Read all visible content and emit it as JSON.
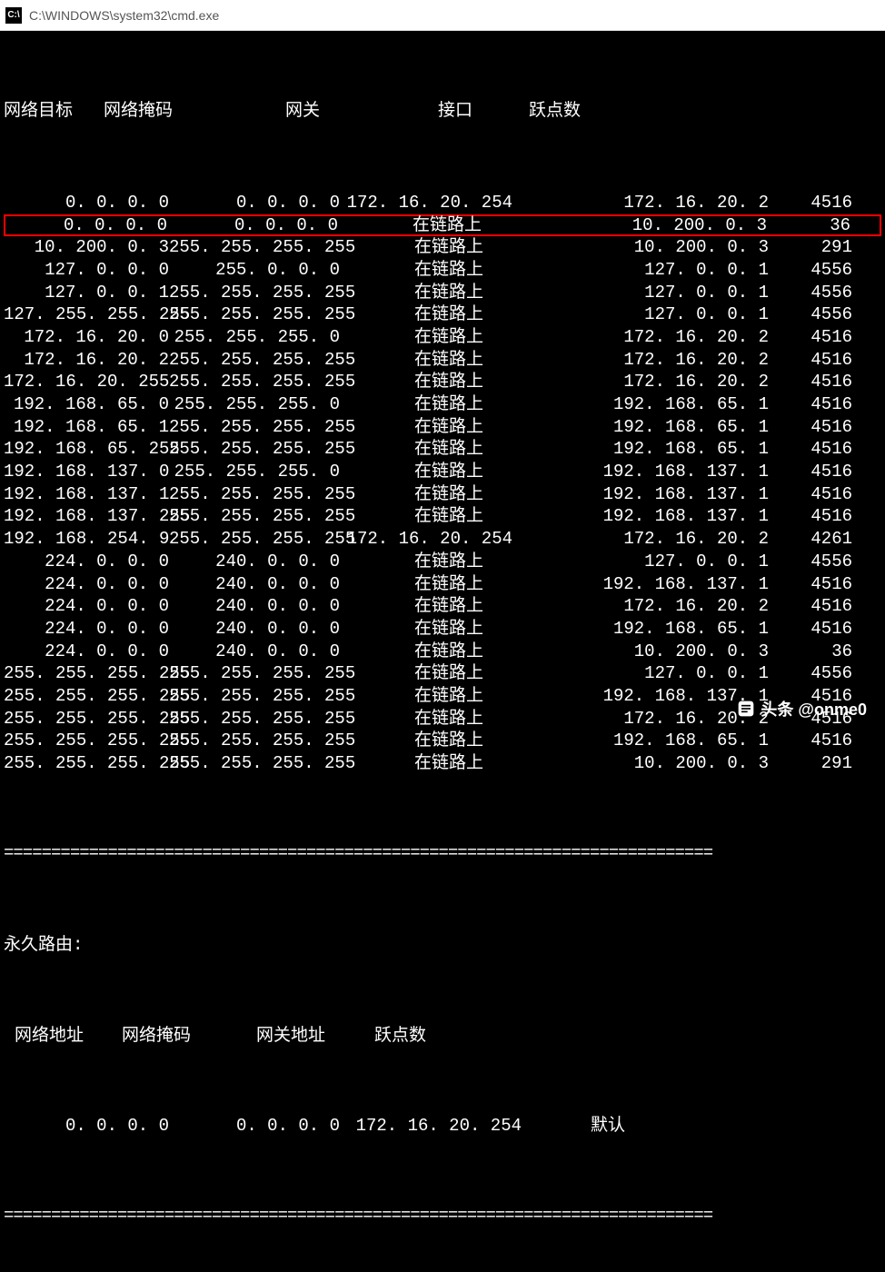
{
  "titlebar": {
    "icon_label": "C:\\",
    "title": "C:\\WINDOWS\\system32\\cmd.exe"
  },
  "headers": {
    "dest": "网络目标",
    "mask": "网络掩码",
    "gateway": "网关",
    "interface": "接口",
    "metric": "跃点数"
  },
  "routes": [
    {
      "dest": "0.0.0.0",
      "mask": "0.0.0.0",
      "gw": "172.16.20.254",
      "if": "172.16.20.2",
      "metric": "4516",
      "hl": false
    },
    {
      "dest": "0.0.0.0",
      "mask": "0.0.0.0",
      "gw": "在链路上",
      "if": "10.200.0.3",
      "metric": "36",
      "hl": true
    },
    {
      "dest": "10.200.0.3",
      "mask": "255.255.255.255",
      "gw": "在链路上",
      "if": "10.200.0.3",
      "metric": "291",
      "hl": false
    },
    {
      "dest": "127.0.0.0",
      "mask": "255.0.0.0",
      "gw": "在链路上",
      "if": "127.0.0.1",
      "metric": "4556",
      "hl": false
    },
    {
      "dest": "127.0.0.1",
      "mask": "255.255.255.255",
      "gw": "在链路上",
      "if": "127.0.0.1",
      "metric": "4556",
      "hl": false
    },
    {
      "dest": "127.255.255.255",
      "mask": "255.255.255.255",
      "gw": "在链路上",
      "if": "127.0.0.1",
      "metric": "4556",
      "hl": false
    },
    {
      "dest": "172.16.20.0",
      "mask": "255.255.255.0",
      "gw": "在链路上",
      "if": "172.16.20.2",
      "metric": "4516",
      "hl": false
    },
    {
      "dest": "172.16.20.2",
      "mask": "255.255.255.255",
      "gw": "在链路上",
      "if": "172.16.20.2",
      "metric": "4516",
      "hl": false
    },
    {
      "dest": "172.16.20.255",
      "mask": "255.255.255.255",
      "gw": "在链路上",
      "if": "172.16.20.2",
      "metric": "4516",
      "hl": false
    },
    {
      "dest": "192.168.65.0",
      "mask": "255.255.255.0",
      "gw": "在链路上",
      "if": "192.168.65.1",
      "metric": "4516",
      "hl": false
    },
    {
      "dest": "192.168.65.1",
      "mask": "255.255.255.255",
      "gw": "在链路上",
      "if": "192.168.65.1",
      "metric": "4516",
      "hl": false
    },
    {
      "dest": "192.168.65.255",
      "mask": "255.255.255.255",
      "gw": "在链路上",
      "if": "192.168.65.1",
      "metric": "4516",
      "hl": false
    },
    {
      "dest": "192.168.137.0",
      "mask": "255.255.255.0",
      "gw": "在链路上",
      "if": "192.168.137.1",
      "metric": "4516",
      "hl": false
    },
    {
      "dest": "192.168.137.1",
      "mask": "255.255.255.255",
      "gw": "在链路上",
      "if": "192.168.137.1",
      "metric": "4516",
      "hl": false
    },
    {
      "dest": "192.168.137.255",
      "mask": "255.255.255.255",
      "gw": "在链路上",
      "if": "192.168.137.1",
      "metric": "4516",
      "hl": false
    },
    {
      "dest": "192.168.254.9",
      "mask": "255.255.255.255",
      "gw": "172.16.20.254",
      "if": "172.16.20.2",
      "metric": "4261",
      "hl": false
    },
    {
      "dest": "224.0.0.0",
      "mask": "240.0.0.0",
      "gw": "在链路上",
      "if": "127.0.0.1",
      "metric": "4556",
      "hl": false
    },
    {
      "dest": "224.0.0.0",
      "mask": "240.0.0.0",
      "gw": "在链路上",
      "if": "192.168.137.1",
      "metric": "4516",
      "hl": false
    },
    {
      "dest": "224.0.0.0",
      "mask": "240.0.0.0",
      "gw": "在链路上",
      "if": "172.16.20.2",
      "metric": "4516",
      "hl": false
    },
    {
      "dest": "224.0.0.0",
      "mask": "240.0.0.0",
      "gw": "在链路上",
      "if": "192.168.65.1",
      "metric": "4516",
      "hl": false
    },
    {
      "dest": "224.0.0.0",
      "mask": "240.0.0.0",
      "gw": "在链路上",
      "if": "10.200.0.3",
      "metric": "36",
      "hl": false
    },
    {
      "dest": "255.255.255.255",
      "mask": "255.255.255.255",
      "gw": "在链路上",
      "if": "127.0.0.1",
      "metric": "4556",
      "hl": false
    },
    {
      "dest": "255.255.255.255",
      "mask": "255.255.255.255",
      "gw": "在链路上",
      "if": "192.168.137.1",
      "metric": "4516",
      "hl": false
    },
    {
      "dest": "255.255.255.255",
      "mask": "255.255.255.255",
      "gw": "在链路上",
      "if": "172.16.20.2",
      "metric": "4516",
      "hl": false
    },
    {
      "dest": "255.255.255.255",
      "mask": "255.255.255.255",
      "gw": "在链路上",
      "if": "192.168.65.1",
      "metric": "4516",
      "hl": false
    },
    {
      "dest": "255.255.255.255",
      "mask": "255.255.255.255",
      "gw": "在链路上",
      "if": "10.200.0.3",
      "metric": "291",
      "hl": false
    }
  ],
  "separator": "===========================================================================",
  "permanent": {
    "title": "永久路由:",
    "headers": {
      "addr": "网络地址",
      "mask": "网络掩码",
      "gw": "网关地址",
      "metric": "跃点数"
    },
    "rows": [
      {
        "addr": "0.0.0.0",
        "mask": "0.0.0.0",
        "gw": "172.16.20.254",
        "metric": "默认"
      }
    ]
  },
  "watermark": "头条 @onme0"
}
